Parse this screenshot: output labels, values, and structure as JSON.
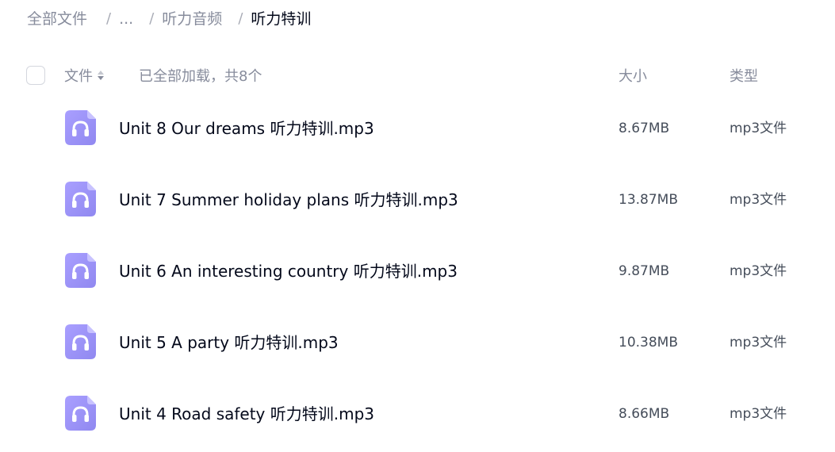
{
  "breadcrumb": {
    "root": "全部文件",
    "ellipsis": "...",
    "parent": "听力音频",
    "current": "听力特训",
    "separator": "/"
  },
  "header": {
    "file_label": "文件",
    "load_status": "已全部加载，共8个",
    "size_label": "大小",
    "type_label": "类型"
  },
  "colors": {
    "icon_gradient_start": "#a79cff",
    "icon_gradient_end": "#8f86f2"
  },
  "files": [
    {
      "name": "Unit 8 Our dreams 听力特训.mp3",
      "size": "8.67MB",
      "type": "mp3文件",
      "icon": "headphones-icon"
    },
    {
      "name": "Unit 7 Summer holiday plans 听力特训.mp3",
      "size": "13.87MB",
      "type": "mp3文件",
      "icon": "headphones-icon"
    },
    {
      "name": "Unit 6 An interesting country 听力特训.mp3",
      "size": "9.87MB",
      "type": "mp3文件",
      "icon": "headphones-icon"
    },
    {
      "name": "Unit 5 A party 听力特训.mp3",
      "size": "10.38MB",
      "type": "mp3文件",
      "icon": "headphones-icon"
    },
    {
      "name": "Unit 4 Road safety 听力特训.mp3",
      "size": "8.66MB",
      "type": "mp3文件",
      "icon": "headphones-icon"
    }
  ]
}
